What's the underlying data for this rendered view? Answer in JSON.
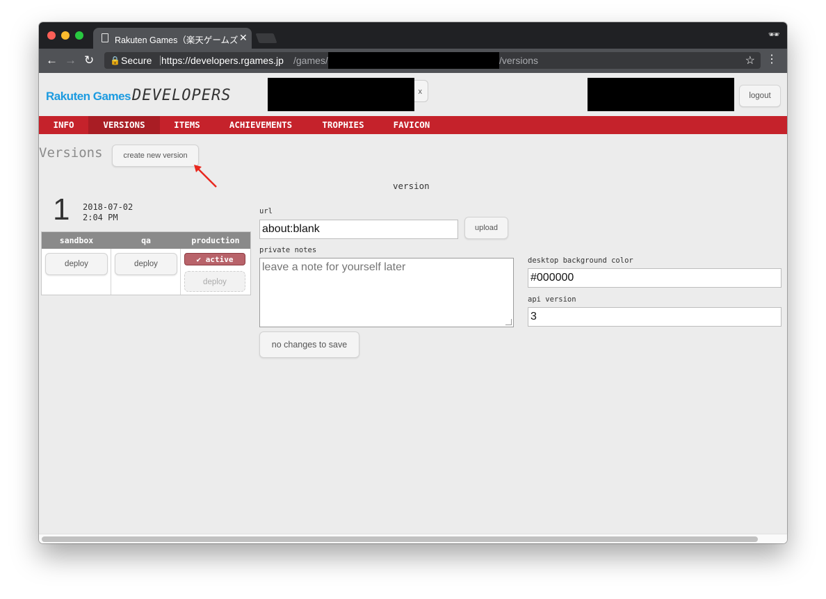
{
  "browser": {
    "tab_title": "Rakuten Games（楽天ゲームズ",
    "secure_label": "Secure",
    "url_host": "https://developers.rgames.jp",
    "url_path_prefix": "/games/",
    "url_path_suffix": "/versions"
  },
  "header": {
    "logo_brand": "Rakuten Games",
    "logo_suffix": "DEVELOPERS",
    "partial_button_text": "x",
    "logout_label": "logout"
  },
  "nav": {
    "items": [
      "INFO",
      "VERSIONS",
      "ITEMS",
      "ACHIEVEMENTS",
      "TROPHIES",
      "FAVICON"
    ],
    "active": "VERSIONS",
    "color": "#c5222b"
  },
  "versions": {
    "title": "Versions",
    "create_label": "create new version",
    "number": "1",
    "date": "2018-07-02",
    "time": "2:04 PM",
    "environments": [
      "sandbox",
      "qa",
      "production"
    ],
    "deploy_label": "deploy",
    "active_label": "active"
  },
  "form": {
    "heading": "version",
    "url_label": "url",
    "url_value": "about:blank",
    "upload_label": "upload",
    "notes_label": "private notes",
    "notes_placeholder": "leave a note for yourself later",
    "save_label": "no changes to save",
    "bg_color_label": "desktop background color",
    "bg_color_value": "#000000",
    "api_version_label": "api version",
    "api_version_value": "3"
  }
}
